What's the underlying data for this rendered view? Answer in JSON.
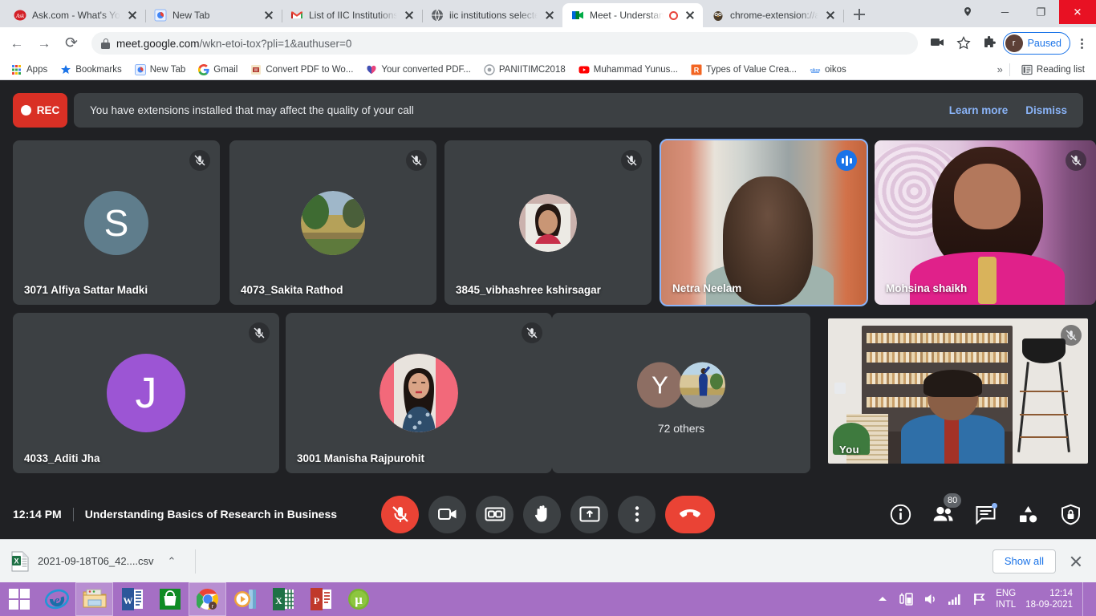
{
  "browser": {
    "tabs": [
      {
        "title": "Ask.com - What's Your Q",
        "favicon": "ask-icon",
        "active": false,
        "recording": false
      },
      {
        "title": "New Tab",
        "favicon": "newtab-icon",
        "active": false,
        "recording": false
      },
      {
        "title": "List of IIC Institutions Se",
        "favicon": "gmail-icon",
        "active": false,
        "recording": false
      },
      {
        "title": "iic institutions selected a",
        "favicon": "globe-icon",
        "active": false,
        "recording": false
      },
      {
        "title": "Meet - Understand",
        "favicon": "meet-icon",
        "active": true,
        "recording": true
      },
      {
        "title": "chrome-extension://app",
        "favicon": "owl-icon",
        "active": false,
        "recording": false
      }
    ],
    "new_tab_label": "+",
    "window_controls": {
      "minimize": "─",
      "maximize": "❐",
      "close": "✕"
    },
    "toolbar": {
      "back": "←",
      "forward": "→",
      "reload": "⟳",
      "url_secure": "meet.google.com",
      "url_path": "/wkn-etoi-tox?pli=1&authuser=0",
      "profile_initial": "r",
      "profile_label": "Paused"
    },
    "bookmarks": [
      {
        "label": "Apps",
        "icon": "apps-grid-icon"
      },
      {
        "label": "Bookmarks",
        "icon": "star-icon"
      },
      {
        "label": "New Tab",
        "icon": "newtab-icon"
      },
      {
        "label": "Gmail",
        "icon": "google-g-icon"
      },
      {
        "label": "Convert PDF to Wo...",
        "icon": "pdf-icon"
      },
      {
        "label": "Your converted PDF...",
        "icon": "heart-icon"
      },
      {
        "label": "PANIITIMC2018",
        "icon": "circle-icon"
      },
      {
        "label": "Muhammad Yunus...",
        "icon": "youtube-icon"
      },
      {
        "label": "Types of Value Crea...",
        "icon": "r-square-icon"
      },
      {
        "label": "oikos",
        "icon": "oikos-icon"
      }
    ],
    "bookmarks_overflow": "»",
    "reading_list": "Reading list"
  },
  "meet": {
    "recording_badge": "REC",
    "banner": {
      "message": "You have extensions installed that may affect the quality of your call",
      "learn_more": "Learn more",
      "dismiss": "Dismiss"
    },
    "participants": [
      {
        "name": "3071 Alfiya Sattar Madki",
        "type": "avatar-letter",
        "letter": "S",
        "avatar_color": "#5f7d8c",
        "muted": true,
        "speaking": false
      },
      {
        "name": "4073_Sakita Rathod",
        "type": "avatar-photo",
        "avatar_color": "#7b8b55",
        "muted": true,
        "speaking": false
      },
      {
        "name": "3845_vibhashree kshirsagar",
        "type": "avatar-photo",
        "avatar_color": "#c9b3ae",
        "muted": true,
        "speaking": false
      },
      {
        "name": "Netra Neelam",
        "type": "video",
        "muted": false,
        "speaking": true
      },
      {
        "name": "Mohsina shaikh",
        "type": "video",
        "muted": true,
        "speaking": false
      },
      {
        "name": "4033_Aditi Jha",
        "type": "avatar-letter",
        "letter": "J",
        "avatar_color": "#9c55d4",
        "muted": true,
        "speaking": false
      },
      {
        "name": "3001 Manisha Rajpurohit",
        "type": "avatar-photo",
        "avatar_color": "#f2697a",
        "muted": true,
        "speaking": false
      },
      {
        "name": "72 others",
        "type": "overflow",
        "letter": "Y",
        "avatar_color": "#8d6e63",
        "muted": false,
        "speaking": false
      },
      {
        "name": "You",
        "type": "video-self",
        "muted": true,
        "speaking": false
      }
    ],
    "footer": {
      "time": "12:14 PM",
      "meeting_title": "Understanding Basics of Research in Business",
      "controls": [
        {
          "name": "microphone-off-button",
          "icon": "mic-off-icon",
          "state": "muted"
        },
        {
          "name": "camera-button",
          "icon": "camera-icon",
          "state": "on"
        },
        {
          "name": "captions-button",
          "icon": "cc-icon",
          "state": "off"
        },
        {
          "name": "raise-hand-button",
          "icon": "hand-icon",
          "state": "off"
        },
        {
          "name": "present-now-button",
          "icon": "present-icon",
          "state": "off"
        },
        {
          "name": "more-options-button",
          "icon": "kebab-icon",
          "state": "off"
        },
        {
          "name": "leave-call-button",
          "icon": "hangup-icon",
          "state": "danger"
        }
      ],
      "right_controls": [
        {
          "name": "meeting-details-button",
          "icon": "info-icon",
          "badge": ""
        },
        {
          "name": "participants-button",
          "icon": "people-icon",
          "badge": "80"
        },
        {
          "name": "chat-button",
          "icon": "chat-icon",
          "badge": "",
          "has_dot": true
        },
        {
          "name": "activities-button",
          "icon": "shapes-icon",
          "badge": ""
        },
        {
          "name": "host-controls-button",
          "icon": "shield-lock-icon",
          "badge": ""
        }
      ]
    }
  },
  "downloads": {
    "file_name": "2021-09-18T06_42....csv",
    "file_icon": "excel-csv-icon",
    "expand_icon": "chevron-up-icon",
    "show_all": "Show all",
    "close_icon": "close-icon"
  },
  "taskbar": {
    "items": [
      {
        "name": "start-button",
        "icon": "windows-logo-icon",
        "open": false
      },
      {
        "name": "internet-explorer-button",
        "icon": "ie-icon",
        "open": false
      },
      {
        "name": "file-explorer-button",
        "icon": "folder-icon",
        "open": true
      },
      {
        "name": "word-button",
        "icon": "word-icon",
        "open": false
      },
      {
        "name": "microsoft-store-button",
        "icon": "store-icon",
        "open": false
      },
      {
        "name": "chrome-button",
        "icon": "chrome-icon",
        "open": true
      },
      {
        "name": "media-player-button",
        "icon": "media-player-icon",
        "open": false
      },
      {
        "name": "excel-button",
        "icon": "excel-icon",
        "open": false
      },
      {
        "name": "powerpoint-button",
        "icon": "powerpoint-icon",
        "open": false
      },
      {
        "name": "utorrent-button",
        "icon": "utorrent-icon",
        "open": false
      }
    ],
    "tray": {
      "language_line1": "ENG",
      "language_line2": "INTL",
      "time": "12:14",
      "date": "18-09-2021"
    }
  }
}
